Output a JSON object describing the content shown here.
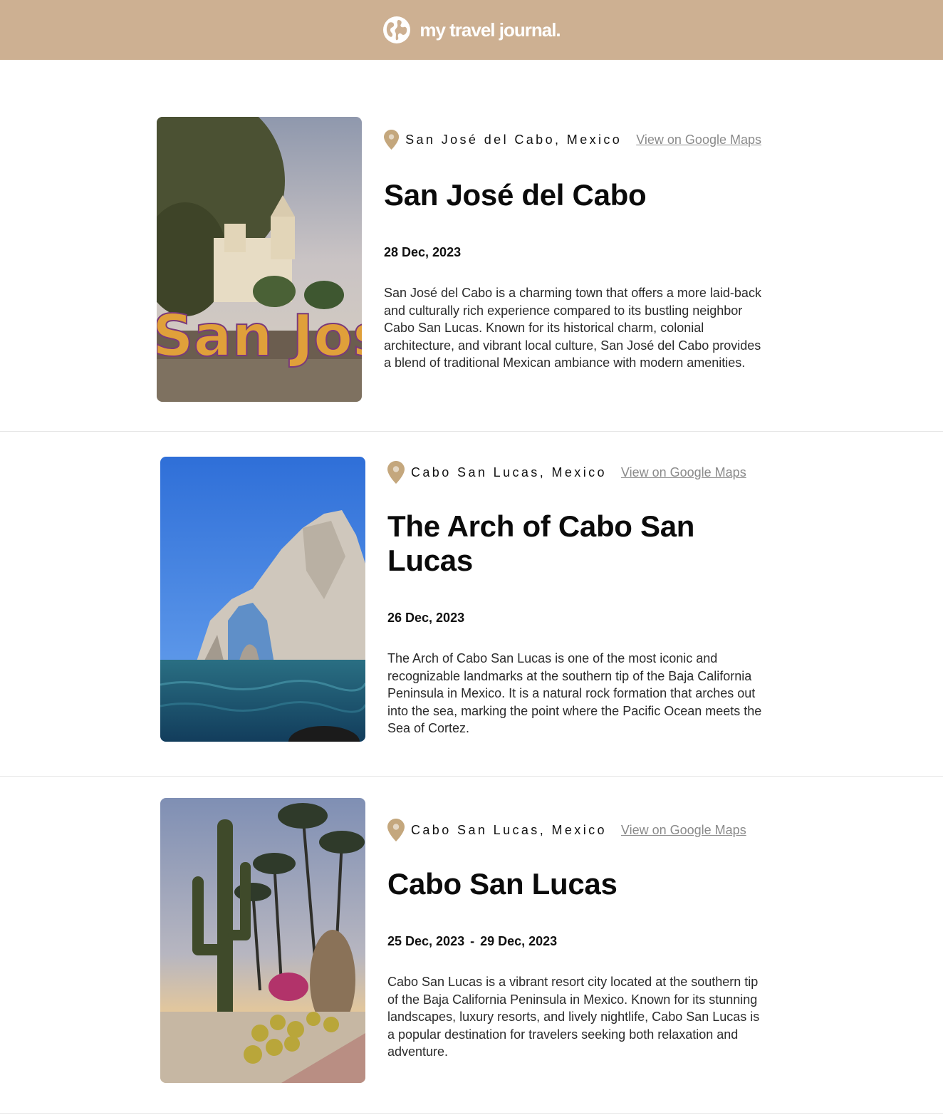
{
  "header": {
    "brand": "my travel journal.",
    "logo_icon": "globe-icon",
    "background": "#CDB092"
  },
  "entries": [
    {
      "location": "San José del Cabo, Mexico",
      "maps_link": "View on Google Maps",
      "title": "San José del Cabo",
      "start_date": "28 Dec, 2023",
      "end_date": "",
      "description": "San José del Cabo is a charming town that offers a more laid-back and culturally rich experience compared to its bustling neighbor Cabo San Lucas. Known for its historical charm, colonial architecture, and vibrant local culture, San José del Cabo provides a blend of traditional Mexican ambiance with modern amenities."
    },
    {
      "location": "Cabo San Lucas, Mexico",
      "maps_link": "View on Google Maps",
      "title": "The Arch of Cabo San Lucas",
      "start_date": "26 Dec, 2023",
      "end_date": "",
      "description": "The Arch of Cabo San Lucas is one of the most iconic and recognizable landmarks at the southern tip of the Baja California Peninsula in Mexico. It is a natural rock formation that arches out into the sea, marking the point where the Pacific Ocean meets the Sea of Cortez."
    },
    {
      "location": "Cabo San Lucas, Mexico",
      "maps_link": "View on Google Maps",
      "title": "Cabo San Lucas",
      "start_date": "25 Dec, 2023",
      "date_separator": "-",
      "end_date": "29 Dec, 2023",
      "description": "Cabo San Lucas is a vibrant resort city located at the southern tip of the Baja California Peninsula in Mexico. Known for its stunning landscapes, luxury resorts, and lively nightlife, Cabo San Lucas is a popular destination for travelers seeking both relaxation and adventure."
    }
  ],
  "colors": {
    "accent": "#CDB092",
    "pin": "#C4A77D",
    "link": "#8a8a8a"
  }
}
